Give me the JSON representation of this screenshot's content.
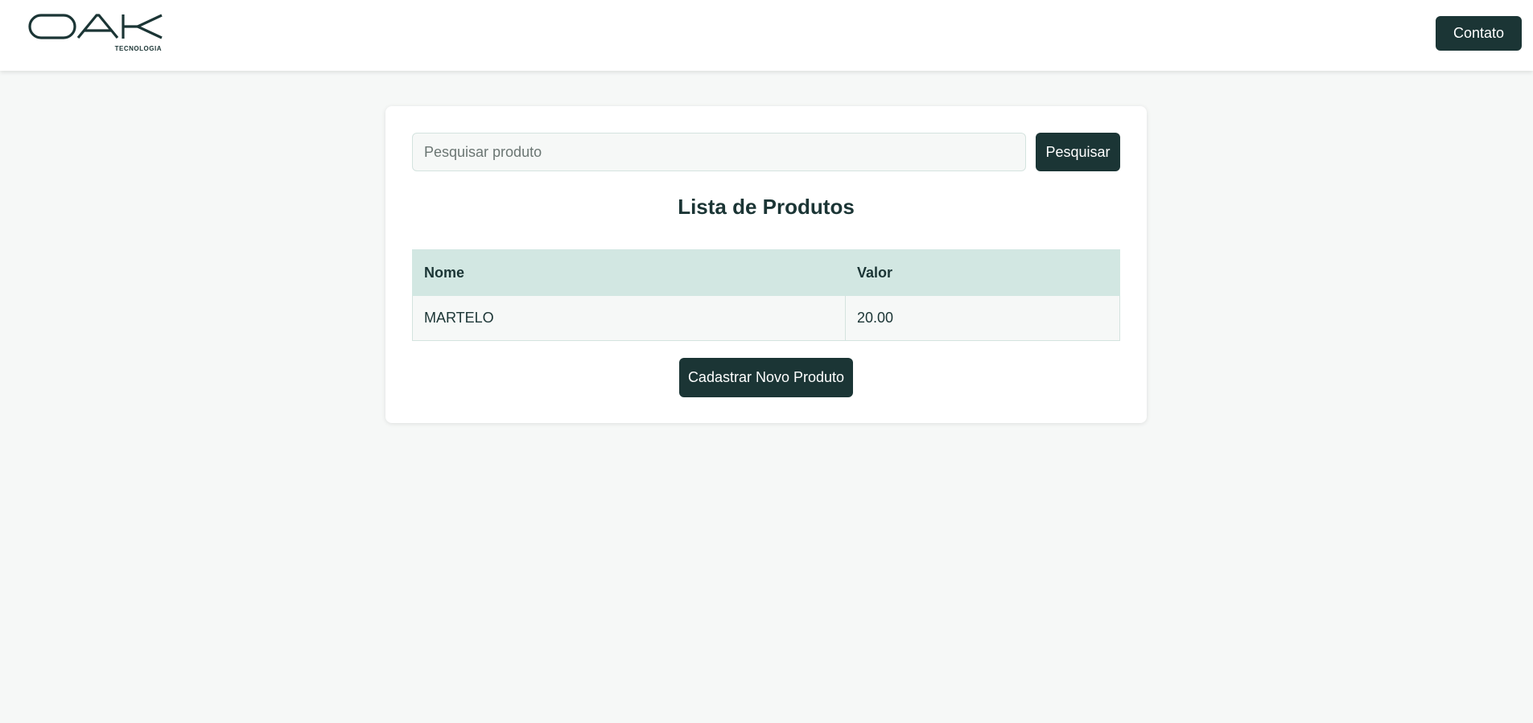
{
  "header": {
    "logo_text": "OAK",
    "logo_tagline": "TECNOLOGIA",
    "contact_label": "Contato"
  },
  "search": {
    "placeholder": "Pesquisar produto",
    "value": "",
    "button_label": "Pesquisar"
  },
  "main": {
    "title": "Lista de Produtos",
    "table": {
      "columns": [
        "Nome",
        "Valor"
      ],
      "rows": [
        {
          "nome": "MARTELO",
          "valor": "20.00"
        }
      ]
    },
    "new_product_label": "Cadastrar Novo Produto"
  },
  "colors": {
    "primary": "#1b3535",
    "page_background": "#f6f8f7",
    "table_header_background": "#d2e7e2",
    "card_background": "#ffffff"
  }
}
